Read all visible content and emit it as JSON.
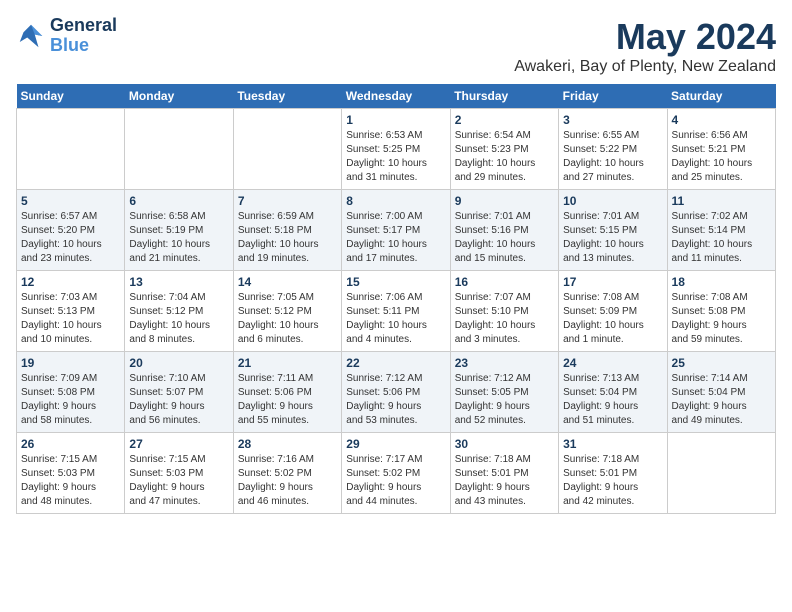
{
  "header": {
    "logo_line1": "General",
    "logo_line2": "Blue",
    "title": "May 2024",
    "subtitle": "Awakeri, Bay of Plenty, New Zealand"
  },
  "days_of_week": [
    "Sunday",
    "Monday",
    "Tuesday",
    "Wednesday",
    "Thursday",
    "Friday",
    "Saturday"
  ],
  "weeks": [
    [
      {
        "day": "",
        "info": ""
      },
      {
        "day": "",
        "info": ""
      },
      {
        "day": "",
        "info": ""
      },
      {
        "day": "1",
        "info": "Sunrise: 6:53 AM\nSunset: 5:25 PM\nDaylight: 10 hours\nand 31 minutes."
      },
      {
        "day": "2",
        "info": "Sunrise: 6:54 AM\nSunset: 5:23 PM\nDaylight: 10 hours\nand 29 minutes."
      },
      {
        "day": "3",
        "info": "Sunrise: 6:55 AM\nSunset: 5:22 PM\nDaylight: 10 hours\nand 27 minutes."
      },
      {
        "day": "4",
        "info": "Sunrise: 6:56 AM\nSunset: 5:21 PM\nDaylight: 10 hours\nand 25 minutes."
      }
    ],
    [
      {
        "day": "5",
        "info": "Sunrise: 6:57 AM\nSunset: 5:20 PM\nDaylight: 10 hours\nand 23 minutes."
      },
      {
        "day": "6",
        "info": "Sunrise: 6:58 AM\nSunset: 5:19 PM\nDaylight: 10 hours\nand 21 minutes."
      },
      {
        "day": "7",
        "info": "Sunrise: 6:59 AM\nSunset: 5:18 PM\nDaylight: 10 hours\nand 19 minutes."
      },
      {
        "day": "8",
        "info": "Sunrise: 7:00 AM\nSunset: 5:17 PM\nDaylight: 10 hours\nand 17 minutes."
      },
      {
        "day": "9",
        "info": "Sunrise: 7:01 AM\nSunset: 5:16 PM\nDaylight: 10 hours\nand 15 minutes."
      },
      {
        "day": "10",
        "info": "Sunrise: 7:01 AM\nSunset: 5:15 PM\nDaylight: 10 hours\nand 13 minutes."
      },
      {
        "day": "11",
        "info": "Sunrise: 7:02 AM\nSunset: 5:14 PM\nDaylight: 10 hours\nand 11 minutes."
      }
    ],
    [
      {
        "day": "12",
        "info": "Sunrise: 7:03 AM\nSunset: 5:13 PM\nDaylight: 10 hours\nand 10 minutes."
      },
      {
        "day": "13",
        "info": "Sunrise: 7:04 AM\nSunset: 5:12 PM\nDaylight: 10 hours\nand 8 minutes."
      },
      {
        "day": "14",
        "info": "Sunrise: 7:05 AM\nSunset: 5:12 PM\nDaylight: 10 hours\nand 6 minutes."
      },
      {
        "day": "15",
        "info": "Sunrise: 7:06 AM\nSunset: 5:11 PM\nDaylight: 10 hours\nand 4 minutes."
      },
      {
        "day": "16",
        "info": "Sunrise: 7:07 AM\nSunset: 5:10 PM\nDaylight: 10 hours\nand 3 minutes."
      },
      {
        "day": "17",
        "info": "Sunrise: 7:08 AM\nSunset: 5:09 PM\nDaylight: 10 hours\nand 1 minute."
      },
      {
        "day": "18",
        "info": "Sunrise: 7:08 AM\nSunset: 5:08 PM\nDaylight: 9 hours\nand 59 minutes."
      }
    ],
    [
      {
        "day": "19",
        "info": "Sunrise: 7:09 AM\nSunset: 5:08 PM\nDaylight: 9 hours\nand 58 minutes."
      },
      {
        "day": "20",
        "info": "Sunrise: 7:10 AM\nSunset: 5:07 PM\nDaylight: 9 hours\nand 56 minutes."
      },
      {
        "day": "21",
        "info": "Sunrise: 7:11 AM\nSunset: 5:06 PM\nDaylight: 9 hours\nand 55 minutes."
      },
      {
        "day": "22",
        "info": "Sunrise: 7:12 AM\nSunset: 5:06 PM\nDaylight: 9 hours\nand 53 minutes."
      },
      {
        "day": "23",
        "info": "Sunrise: 7:12 AM\nSunset: 5:05 PM\nDaylight: 9 hours\nand 52 minutes."
      },
      {
        "day": "24",
        "info": "Sunrise: 7:13 AM\nSunset: 5:04 PM\nDaylight: 9 hours\nand 51 minutes."
      },
      {
        "day": "25",
        "info": "Sunrise: 7:14 AM\nSunset: 5:04 PM\nDaylight: 9 hours\nand 49 minutes."
      }
    ],
    [
      {
        "day": "26",
        "info": "Sunrise: 7:15 AM\nSunset: 5:03 PM\nDaylight: 9 hours\nand 48 minutes."
      },
      {
        "day": "27",
        "info": "Sunrise: 7:15 AM\nSunset: 5:03 PM\nDaylight: 9 hours\nand 47 minutes."
      },
      {
        "day": "28",
        "info": "Sunrise: 7:16 AM\nSunset: 5:02 PM\nDaylight: 9 hours\nand 46 minutes."
      },
      {
        "day": "29",
        "info": "Sunrise: 7:17 AM\nSunset: 5:02 PM\nDaylight: 9 hours\nand 44 minutes."
      },
      {
        "day": "30",
        "info": "Sunrise: 7:18 AM\nSunset: 5:01 PM\nDaylight: 9 hours\nand 43 minutes."
      },
      {
        "day": "31",
        "info": "Sunrise: 7:18 AM\nSunset: 5:01 PM\nDaylight: 9 hours\nand 42 minutes."
      },
      {
        "day": "",
        "info": ""
      }
    ]
  ]
}
